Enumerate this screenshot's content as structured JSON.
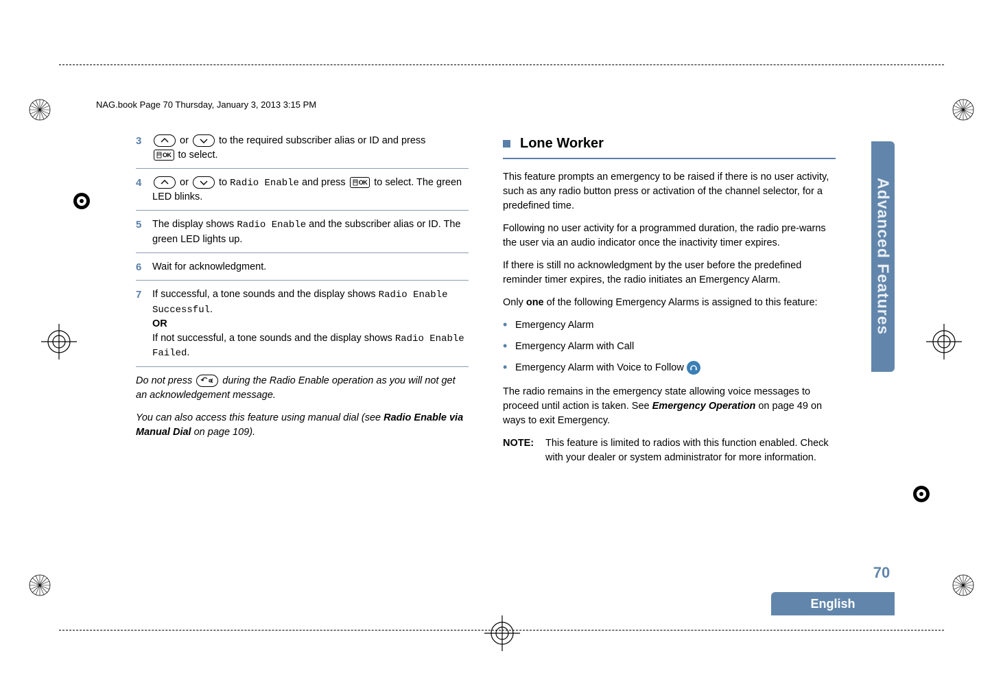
{
  "header": "NAG.book  Page 70  Thursday, January 3, 2013  3:15 PM",
  "left": {
    "steps": {
      "s3": {
        "num": "3",
        "pre": " or ",
        "post": " to the required subscriber alias or ID and press ",
        "end": " to select."
      },
      "s4": {
        "num": "4",
        "pre": " or ",
        "mid": " to ",
        "code": "Radio Enable",
        "post": " and press ",
        "end": " to select. The green LED blinks."
      },
      "s5": {
        "num": "5",
        "pre": "The display shows ",
        "code": "Radio Enable",
        "post": " and the subscriber alias or ID. The green LED lights up."
      },
      "s6": {
        "num": "6",
        "text": "Wait for acknowledgment."
      },
      "s7": {
        "num": "7",
        "l1a": "If successful, a tone sounds and the display shows ",
        "l1code": "Radio Enable Successful",
        "or": "OR",
        "l2a": "If not successful, a tone sounds and the display shows ",
        "l2code": "Radio Enable Failed"
      }
    },
    "para1a": "Do not press ",
    "para1b": " during the Radio Enable operation as you will not get an acknowledgement message.",
    "para2a": "You can also access this feature using manual dial (see ",
    "para2b": "Radio Enable via Manual Dial",
    "para2c": " on page 109)."
  },
  "right": {
    "heading": "Lone Worker",
    "p1": "This feature prompts an emergency to be raised if there is no user activity, such as any radio button press or activation of the channel selector, for a predefined time.",
    "p2": "Following no user activity for a programmed duration, the radio pre-warns the user via an audio indicator once the the inactivity timer expires.",
    "p2fix": "Following no user activity for a programmed duration, the radio pre-warns the user via an audio indicator once the inactivity timer expires.",
    "p3": "If there is still no acknowledgment by the user before the predefined reminder timer expires, the radio initiates an Emergency Alarm.",
    "p4a": "Only ",
    "p4b": "one",
    "p4c": " of the following Emergency Alarms is assigned to this feature:",
    "bullets": {
      "b1": "Emergency Alarm",
      "b2": "Emergency Alarm with Call",
      "b3": "Emergency Alarm with Voice to Follow"
    },
    "p5a": "The radio remains in the emergency state allowing voice messages to proceed until action is taken. See ",
    "p5b": "Emergency Operation",
    "p5c": " on page 49 on ways to exit Emergency.",
    "noteLabel": "NOTE:",
    "noteText": "This feature is limited to radios with this function enabled. Check with your dealer or system administrator for more information."
  },
  "sideTab": "Advanced Features",
  "pageNum": "70",
  "footerTab": "English",
  "okLabel": "OK"
}
